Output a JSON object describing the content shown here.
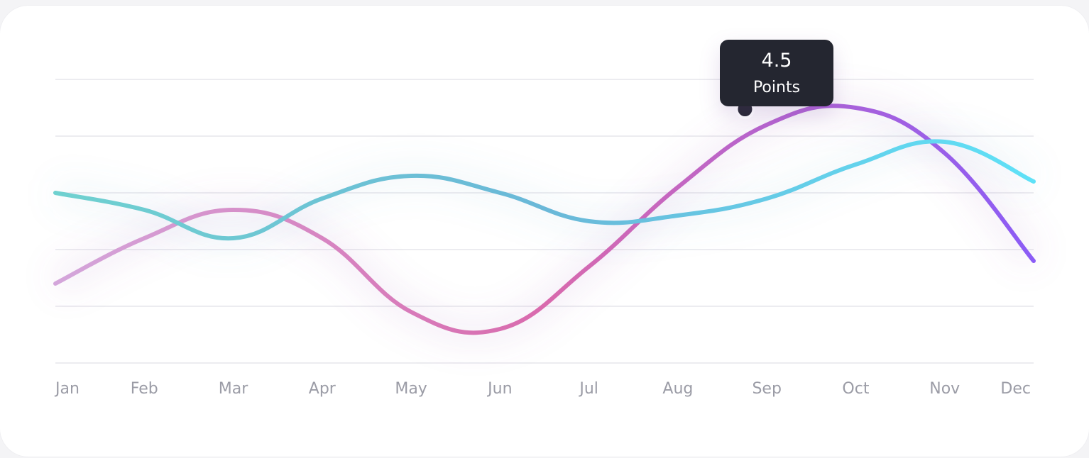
{
  "chart_data": {
    "type": "line",
    "categories": [
      "Jan",
      "Feb",
      "Mar",
      "Apr",
      "May",
      "Jun",
      "Jul",
      "Aug",
      "Sep",
      "Oct",
      "Nov",
      "Dec"
    ],
    "ylim": [
      0,
      5
    ],
    "grid": true,
    "series": [
      {
        "color_start": "#d4a6db",
        "color_mid": "#d96aad",
        "color_end": "#8b5cf6",
        "values": [
          1.4,
          2.2,
          2.7,
          2.2,
          0.9,
          0.6,
          1.7,
          3.1,
          4.2,
          4.5,
          3.7,
          1.8
        ]
      },
      {
        "color_start": "#6fd1d0",
        "color_mid": "#6ab8d8",
        "color_end": "#5fe1f7",
        "values": [
          3.0,
          2.7,
          2.2,
          2.9,
          3.3,
          3.0,
          2.5,
          2.6,
          2.9,
          3.5,
          3.9,
          3.2
        ]
      }
    ],
    "gridline_values": [
      0,
      1,
      2,
      3,
      4,
      5
    ],
    "tooltip": {
      "value": "4.5",
      "unit": "Points"
    }
  }
}
